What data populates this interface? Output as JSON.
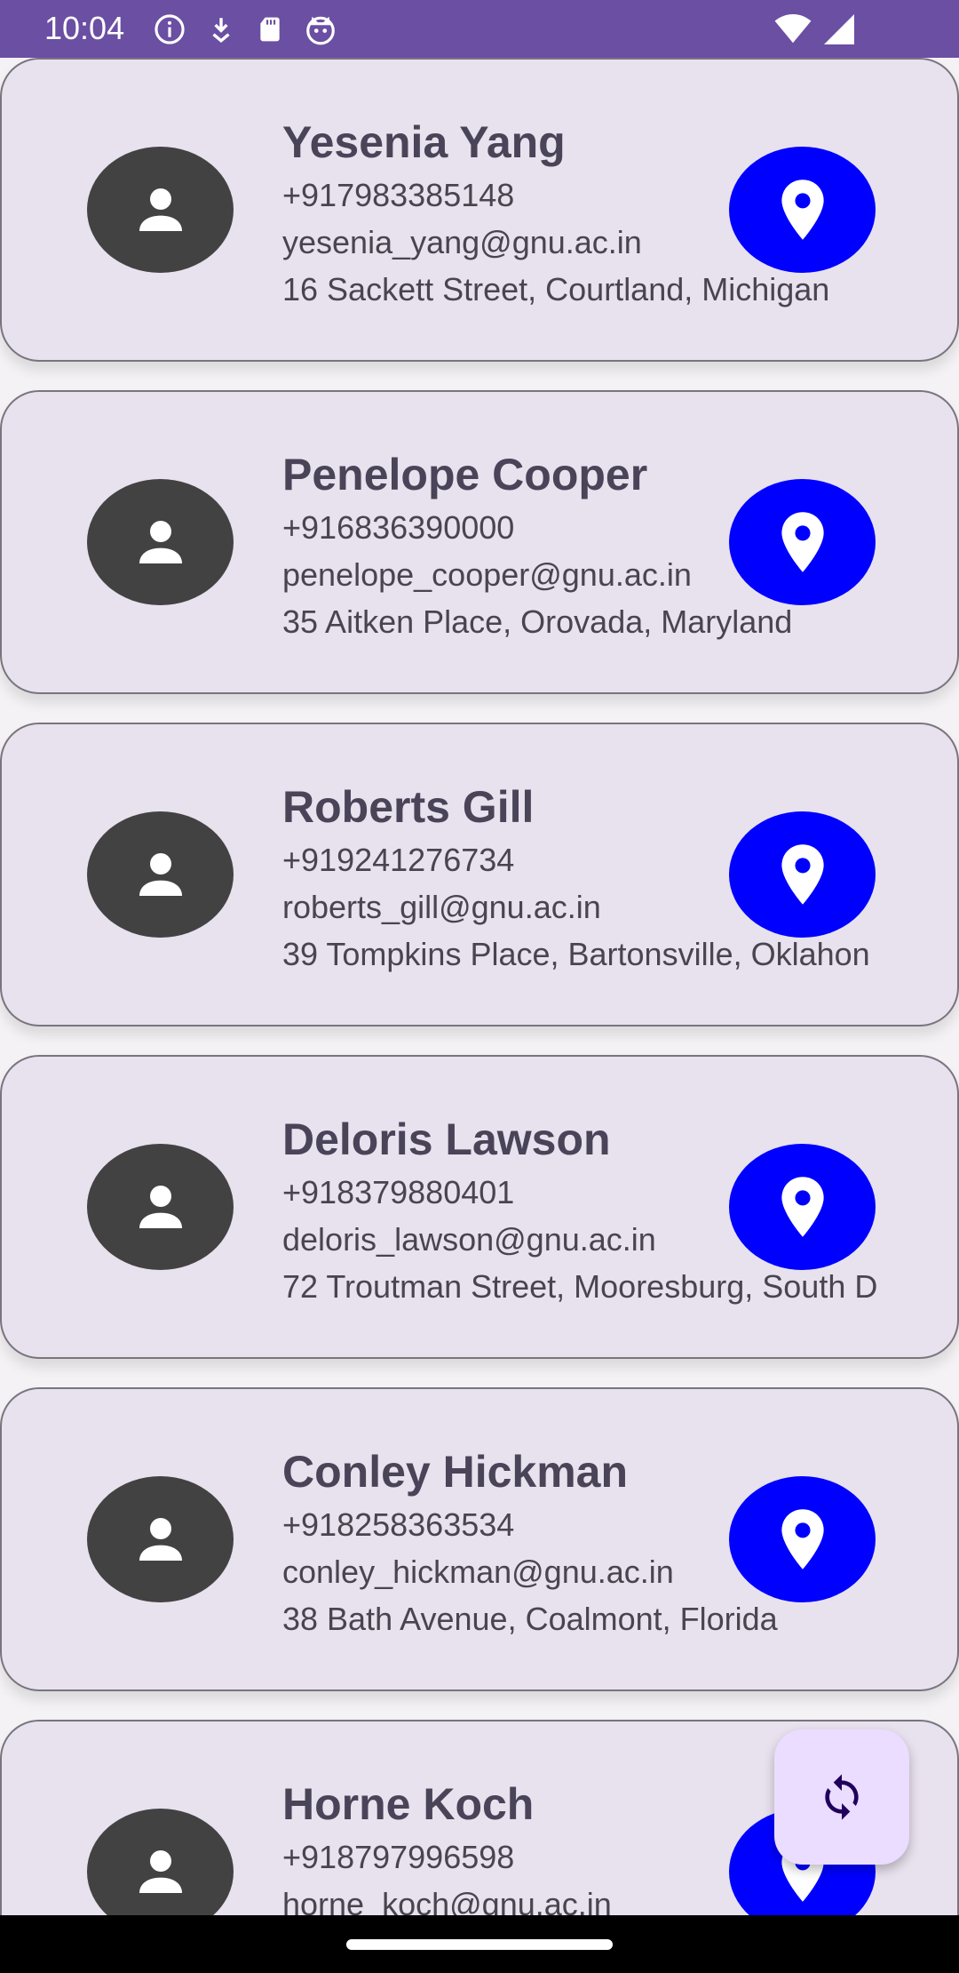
{
  "status_bar": {
    "time": "10:04",
    "icons": [
      "info-icon",
      "download-icon",
      "sd-card-icon",
      "cat-icon",
      "wifi-icon",
      "signal-icon"
    ]
  },
  "colors": {
    "status_bar": "#6a4fa3",
    "card_background": "#e8e1ee",
    "avatar": "#424242",
    "location_button": "#0000ff",
    "fab": "#eaddff"
  },
  "contacts": [
    {
      "name": "Yesenia Yang",
      "phone": "+917983385148",
      "email": "yesenia_yang@gnu.ac.in",
      "address": "16 Sackett Street, Courtland, Michigan"
    },
    {
      "name": "Penelope Cooper",
      "phone": "+916836390000",
      "email": "penelope_cooper@gnu.ac.in",
      "address": "35 Aitken Place, Orovada, Maryland"
    },
    {
      "name": "Roberts Gill",
      "phone": "+919241276734",
      "email": "roberts_gill@gnu.ac.in",
      "address": "39 Tompkins Place, Bartonsville, Oklahon"
    },
    {
      "name": "Deloris Lawson",
      "phone": "+918379880401",
      "email": "deloris_lawson@gnu.ac.in",
      "address": "72 Troutman Street, Mooresburg, South D"
    },
    {
      "name": "Conley Hickman",
      "phone": "+918258363534",
      "email": "conley_hickman@gnu.ac.in",
      "address": "38 Bath Avenue, Coalmont, Florida"
    },
    {
      "name": "Horne Koch",
      "phone": "+918797996598",
      "email": "horne_koch@gnu.ac.in",
      "address": ""
    }
  ],
  "fab": {
    "icon": "refresh-icon"
  }
}
